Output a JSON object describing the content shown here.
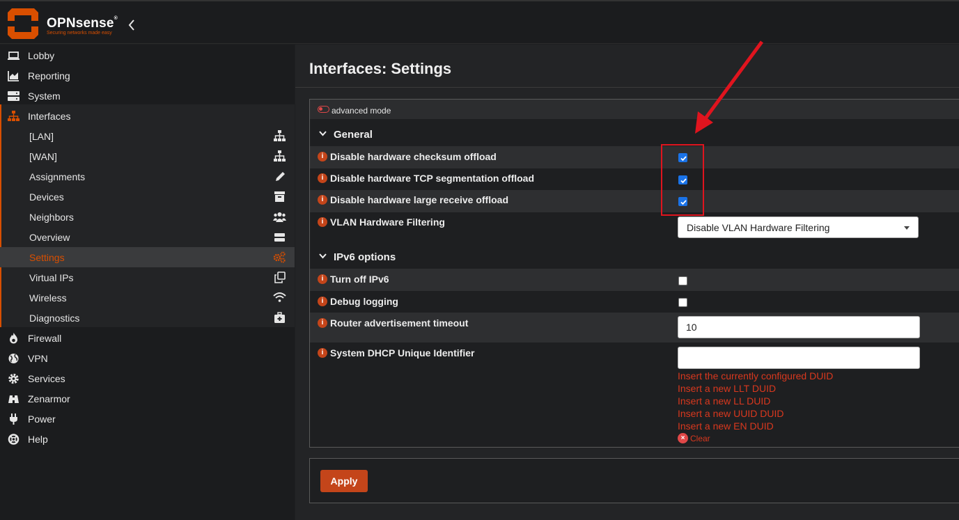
{
  "brand": {
    "name": "OPNsense",
    "trademark": "®",
    "tagline": "Securing networks made easy",
    "accent": "#d94f00"
  },
  "sidebar": {
    "items": [
      {
        "label": "Lobby",
        "icon": "laptop-icon"
      },
      {
        "label": "Reporting",
        "icon": "area-chart-icon"
      },
      {
        "label": "System",
        "icon": "server-icon"
      },
      {
        "label": "Interfaces",
        "icon": "sitemap-icon"
      },
      {
        "label": "Firewall",
        "icon": "fire-icon"
      },
      {
        "label": "VPN",
        "icon": "globe-icon"
      },
      {
        "label": "Services",
        "icon": "cog-icon"
      },
      {
        "label": "Zenarmor",
        "icon": "binoculars-icon"
      },
      {
        "label": "Power",
        "icon": "plug-icon"
      },
      {
        "label": "Help",
        "icon": "life-ring-icon"
      }
    ],
    "interfaces_sub": [
      {
        "label": "[LAN]",
        "icon": "sitemap-icon"
      },
      {
        "label": "[WAN]",
        "icon": "sitemap-icon"
      },
      {
        "label": "Assignments",
        "icon": "pencil-icon"
      },
      {
        "label": "Devices",
        "icon": "archive-icon"
      },
      {
        "label": "Neighbors",
        "icon": "users-icon"
      },
      {
        "label": "Overview",
        "icon": "hdd-icon"
      },
      {
        "label": "Settings",
        "icon": "cogs-icon",
        "active": true
      },
      {
        "label": "Virtual IPs",
        "icon": "clone-icon"
      },
      {
        "label": "Wireless",
        "icon": "wifi-icon"
      },
      {
        "label": "Diagnostics",
        "icon": "medkit-icon"
      }
    ]
  },
  "page": {
    "title": "Interfaces: Settings",
    "advanced_mode_label": "advanced mode"
  },
  "general": {
    "title": "General",
    "checksum_label": "Disable hardware checksum offload",
    "checksum_checked": true,
    "tso_label": "Disable hardware TCP segmentation offload",
    "tso_checked": true,
    "lro_label": "Disable hardware large receive offload",
    "lro_checked": true,
    "vlan_label": "VLAN Hardware Filtering",
    "vlan_value": "Disable VLAN Hardware Filtering"
  },
  "ipv6": {
    "title": "IPv6 options",
    "turnoff_label": "Turn off IPv6",
    "turnoff_checked": false,
    "debug_label": "Debug logging",
    "debug_checked": false,
    "ra_label": "Router advertisement timeout",
    "ra_value": "10",
    "duid_label": "System DHCP Unique Identifier",
    "duid_value": "",
    "duid_links": [
      "Insert the currently configured DUID",
      "Insert a new LLT DUID",
      "Insert a new LL DUID",
      "Insert a new UUID DUID",
      "Insert a new EN DUID"
    ],
    "clear_label": "Clear"
  },
  "actions": {
    "apply_label": "Apply"
  },
  "colors": {
    "apply_button": "#c4451a",
    "checkbox_checked": "#1a73e8",
    "annotation": "#e0141e",
    "link": "#d9381e"
  }
}
